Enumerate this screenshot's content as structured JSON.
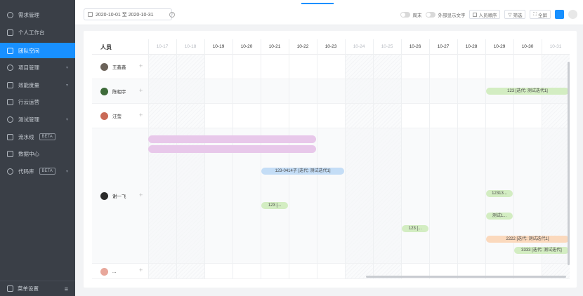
{
  "sidebar": {
    "items": [
      {
        "label": "需求管理",
        "icon": "bulb-icon",
        "active": false,
        "badge": "",
        "chevron": false
      },
      {
        "label": "个人工作台",
        "icon": "grid-icon",
        "active": false,
        "badge": "",
        "chevron": false
      },
      {
        "label": "团队空间",
        "icon": "team-icon",
        "active": true,
        "badge": "",
        "chevron": false
      },
      {
        "label": "项目管理",
        "icon": "project-icon",
        "active": false,
        "badge": "",
        "chevron": true
      },
      {
        "label": "效能度量",
        "icon": "metric-icon",
        "active": false,
        "badge": "",
        "chevron": true
      },
      {
        "label": "行云运营",
        "icon": "ops-icon",
        "active": false,
        "badge": "",
        "chevron": false
      },
      {
        "label": "测试管理",
        "icon": "test-icon",
        "active": false,
        "badge": "",
        "chevron": true
      },
      {
        "label": "流水线",
        "icon": "pipeline-icon",
        "active": false,
        "badge": "BETA",
        "chevron": false
      },
      {
        "label": "数据中心",
        "icon": "data-icon",
        "active": false,
        "badge": "",
        "chevron": false
      },
      {
        "label": "代码库",
        "icon": "code-icon",
        "active": false,
        "badge": "BETA",
        "chevron": true
      }
    ],
    "bottom_label": "菜单设置"
  },
  "toolbar": {
    "date_range": "2020-10-01 至 2020-10-31",
    "toggle_weekend": "周末",
    "toggle_show_text": "外部显示文字",
    "btn_sort": "人员顺序",
    "btn_filter": "筛选",
    "btn_fullscreen": "全屏"
  },
  "gantt": {
    "person_header": "人员",
    "days": [
      "10-17",
      "10-18",
      "10-19",
      "10-20",
      "10-21",
      "10-22",
      "10-23",
      "10-24",
      "10-25",
      "10-26",
      "10-27",
      "10-28",
      "10-29",
      "10-30",
      "10-31"
    ],
    "weekend_days": [
      "10-17",
      "10-18",
      "10-24",
      "10-25",
      "10-31"
    ],
    "members": [
      {
        "name": "王鑫鑫",
        "avatar_color": "#6b6259"
      },
      {
        "name": "陈相宇",
        "avatar_color": "#3e6b3a"
      },
      {
        "name": "汪莹",
        "avatar_color": "#c96a56"
      },
      {
        "name": "谢一飞",
        "avatar_color": "#2a2a2a"
      },
      {
        "name": "...",
        "avatar_color": "#e8a79b"
      }
    ],
    "tasks": [
      {
        "member": "陈相宇",
        "start": "10-29",
        "end": "10-31",
        "label": "123 [迭代: 测试迭代1]",
        "color": "green"
      },
      {
        "member": "谢一飞",
        "start": "10-17",
        "end": "10-22",
        "label": "",
        "color": "purple"
      },
      {
        "member": "谢一飞",
        "start": "10-17",
        "end": "10-22",
        "label": "",
        "color": "purple"
      },
      {
        "member": "谢一飞",
        "start": "10-21",
        "end": "10-23",
        "label": "123-0414子 [迭代: 测试迭代1]",
        "color": "blue"
      },
      {
        "member": "谢一飞",
        "start": "10-29",
        "end": "10-29",
        "label": "12313...",
        "color": "green"
      },
      {
        "member": "谢一飞",
        "start": "10-21",
        "end": "10-21",
        "label": "123 [...",
        "color": "green"
      },
      {
        "member": "谢一飞",
        "start": "10-29",
        "end": "10-29",
        "label": "测试1...",
        "color": "green"
      },
      {
        "member": "谢一飞",
        "start": "10-26",
        "end": "10-26",
        "label": "123 [...",
        "color": "green"
      },
      {
        "member": "谢一飞",
        "start": "10-29",
        "end": "10-31",
        "label": "2222 [迭代: 测试迭代1]",
        "color": "orange"
      },
      {
        "member": "谢一飞",
        "start": "10-30",
        "end": "10-31",
        "label": "3333 [迭代: 测试迭代]",
        "color": "green"
      }
    ]
  }
}
